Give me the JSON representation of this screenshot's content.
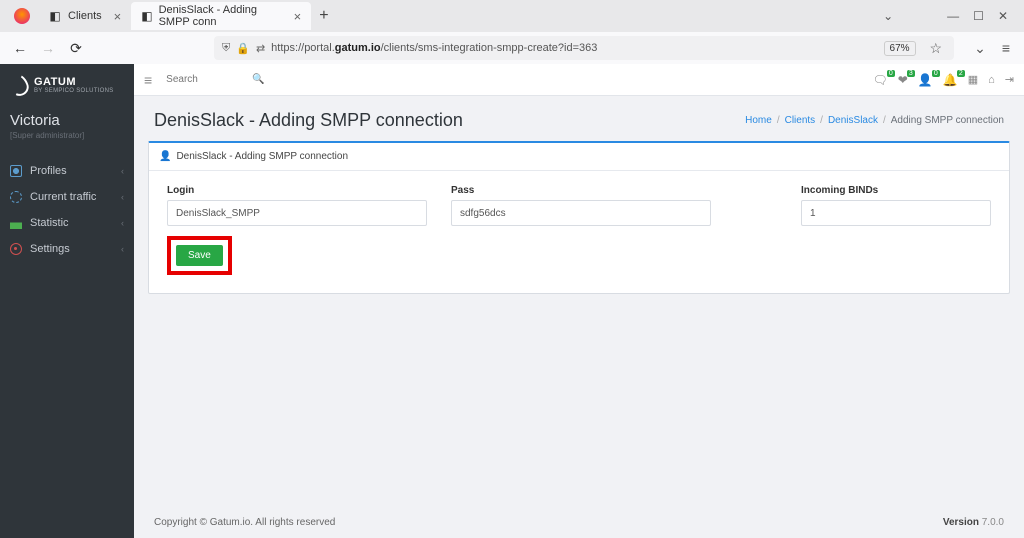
{
  "browser": {
    "tab1_label": "Clients",
    "tab2_label": "DenisSlack - Adding SMPP conn",
    "url_pre": "https://portal.",
    "url_bold": "gatum.io",
    "url_rest": "/clients/sms-integration-smpp-create?id=363",
    "zoom": "67%"
  },
  "logo": {
    "title": "GATUM",
    "subtitle": "BY SEMPICO SOLUTIONS"
  },
  "user": {
    "name": "Victoria",
    "role": "[Super administrator]"
  },
  "nav": {
    "profiles": "Profiles",
    "traffic": "Current traffic",
    "statistic": "Statistic",
    "settings": "Settings"
  },
  "topbar": {
    "search_placeholder": "Search",
    "badges": {
      "a": "0",
      "b": "3",
      "c": "0",
      "d": "2"
    }
  },
  "header": {
    "title": "DenisSlack - Adding SMPP connection"
  },
  "breadcrumb": {
    "home": "Home",
    "clients": "Clients",
    "dennis": "DenisSlack",
    "current": "Adding SMPP connection"
  },
  "panel": {
    "title": "DenisSlack - Adding SMPP connection",
    "login_label": "Login",
    "login_value": "DenisSlack_SMPP",
    "pass_label": "Pass",
    "pass_value": "sdfg56dcs",
    "binds_label": "Incoming BINDs",
    "binds_value": "1",
    "save": "Save"
  },
  "footer": {
    "copyright": "Copyright © Gatum.io. All rights reserved",
    "version_label": "Version",
    "version_value": " 7.0.0"
  }
}
